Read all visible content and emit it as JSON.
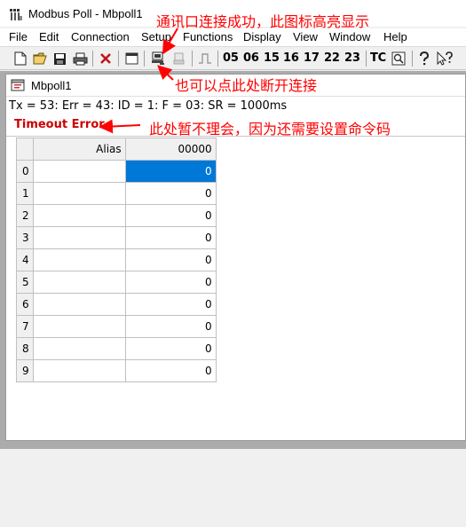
{
  "window": {
    "title": "Modbus Poll - Mbpoll1"
  },
  "menu": [
    "File",
    "Edit",
    "Connection",
    "Setup",
    "Functions",
    "Display",
    "View",
    "Window",
    "Help"
  ],
  "toolbar": {
    "codes": [
      "05",
      "06",
      "15",
      "16",
      "17",
      "22",
      "23"
    ],
    "tc_label": "TC"
  },
  "child": {
    "title": "Mbpoll1",
    "status": "Tx = 53: Err = 43: ID = 1: F = 03: SR = 1000ms",
    "error": "Timeout Error"
  },
  "grid": {
    "col_alias": "Alias",
    "col_value": "00000",
    "rows": [
      {
        "index": "0",
        "alias": "",
        "value": "0"
      },
      {
        "index": "1",
        "alias": "",
        "value": "0"
      },
      {
        "index": "2",
        "alias": "",
        "value": "0"
      },
      {
        "index": "3",
        "alias": "",
        "value": "0"
      },
      {
        "index": "4",
        "alias": "",
        "value": "0"
      },
      {
        "index": "5",
        "alias": "",
        "value": "0"
      },
      {
        "index": "6",
        "alias": "",
        "value": "0"
      },
      {
        "index": "7",
        "alias": "",
        "value": "0"
      },
      {
        "index": "8",
        "alias": "",
        "value": "0"
      },
      {
        "index": "9",
        "alias": "",
        "value": "0"
      }
    ]
  },
  "annotations": {
    "connect_success": "通讯口连接成功，此图标高亮显示",
    "disconnect_hint": "也可以点此处断开连接",
    "ignore_error": "此处暂不理会，因为还需要设置命令码"
  },
  "colors": {
    "annotation": "#ff0000",
    "error": "#cc0000",
    "selection": "#0078d7"
  }
}
